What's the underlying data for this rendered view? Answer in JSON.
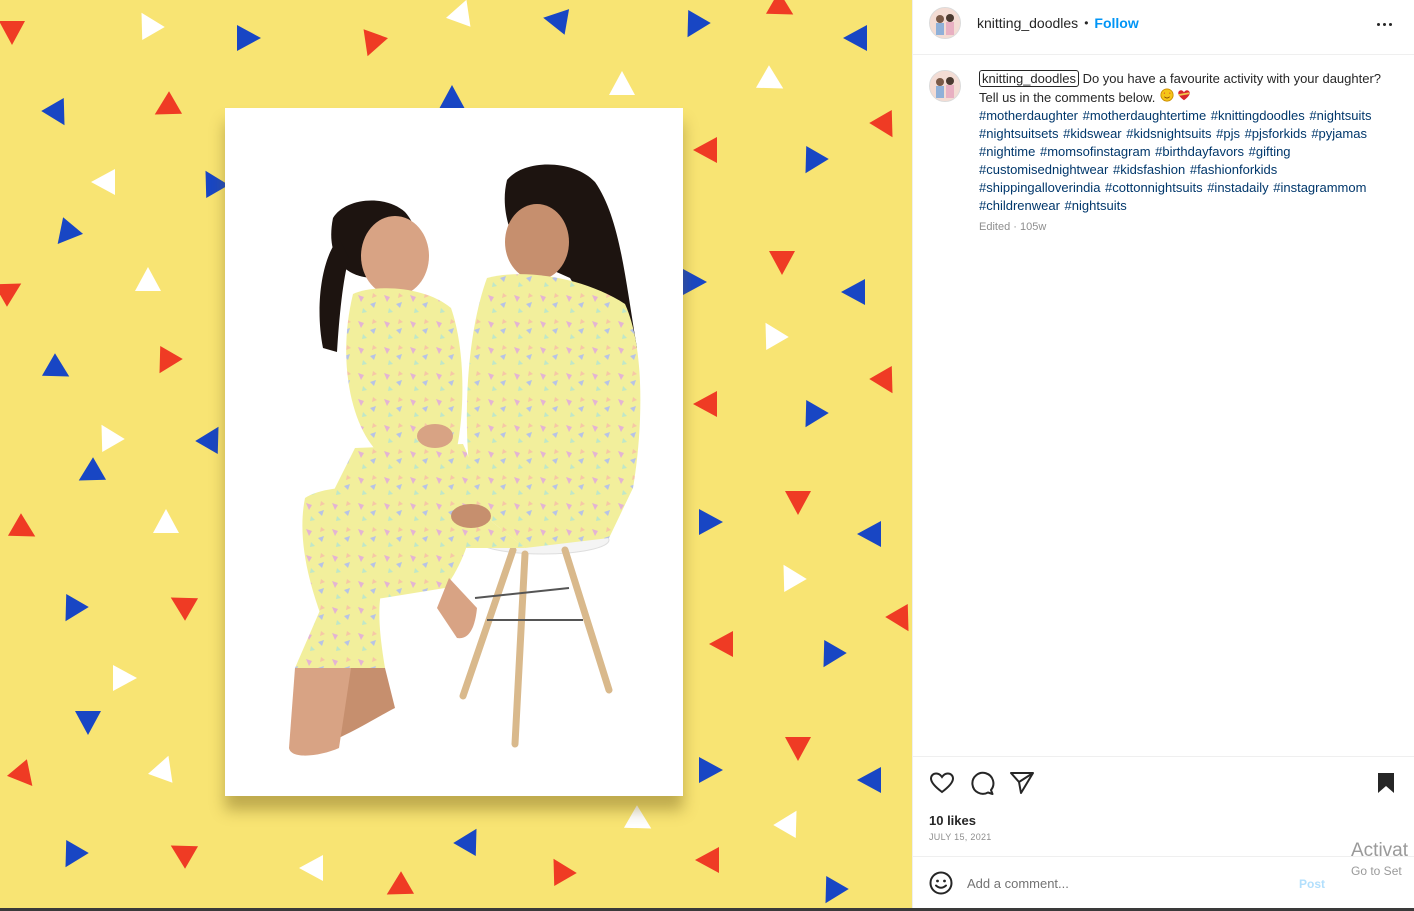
{
  "post": {
    "username": "knitting_doodles",
    "separator": "•",
    "follow_label": "Follow",
    "caption_user": "knitting_doodles",
    "caption_text": " Do you have a favourite activity with your daughter? Tell us in the comments below. ",
    "caption_emojis": [
      "star-struck-emoji",
      "heart-with-ribbon-emoji"
    ],
    "hashtags": "#motherdaughter #motherdaughtertime #knittingdoodles #nightsuits #nightsuitsets #kidswear #kidsnightsuits #pjs #pjsforkids #pyjamas #nightime #momsofinstagram #birthdayfavors #gifting #customisednightwear #kidsfashion #fashionforkids #shippingalloverindia #cottonnightsuits #instadaily #instagrammom #childrenwear #nightsuits",
    "edited_meta": "Edited · 105w",
    "likes": "10 likes",
    "date": "JULY 15, 2021",
    "comment_placeholder": "Add a comment...",
    "post_label": "Post"
  },
  "icons": {
    "more": "more-horizontal-icon",
    "like": "heart-icon",
    "comment": "comment-icon",
    "share": "send-icon",
    "save": "bookmark-icon",
    "emoji": "emoji-icon"
  },
  "watermark": {
    "line1": "Activat",
    "line2": "Go to Set"
  },
  "colors": {
    "media_background": "#f8e473",
    "triangle_red": "#ef3b24",
    "triangle_blue": "#1846c4",
    "triangle_white": "#ffffff",
    "follow_blue": "#0095f6",
    "hashtag_blue": "#00376b",
    "pajama_yellow": "#f3ee9a"
  }
}
